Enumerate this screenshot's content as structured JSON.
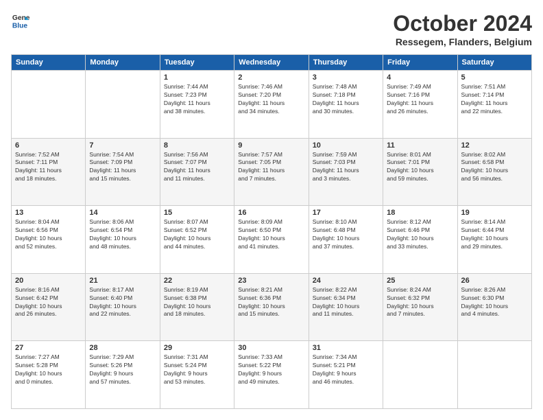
{
  "logo": {
    "line1": "General",
    "line2": "Blue"
  },
  "title": "October 2024",
  "location": "Ressegem, Flanders, Belgium",
  "days": [
    "Sunday",
    "Monday",
    "Tuesday",
    "Wednesday",
    "Thursday",
    "Friday",
    "Saturday"
  ],
  "weeks": [
    [
      {
        "day": "",
        "content": ""
      },
      {
        "day": "",
        "content": ""
      },
      {
        "day": "1",
        "content": "Sunrise: 7:44 AM\nSunset: 7:23 PM\nDaylight: 11 hours\nand 38 minutes."
      },
      {
        "day": "2",
        "content": "Sunrise: 7:46 AM\nSunset: 7:20 PM\nDaylight: 11 hours\nand 34 minutes."
      },
      {
        "day": "3",
        "content": "Sunrise: 7:48 AM\nSunset: 7:18 PM\nDaylight: 11 hours\nand 30 minutes."
      },
      {
        "day": "4",
        "content": "Sunrise: 7:49 AM\nSunset: 7:16 PM\nDaylight: 11 hours\nand 26 minutes."
      },
      {
        "day": "5",
        "content": "Sunrise: 7:51 AM\nSunset: 7:14 PM\nDaylight: 11 hours\nand 22 minutes."
      }
    ],
    [
      {
        "day": "6",
        "content": "Sunrise: 7:52 AM\nSunset: 7:11 PM\nDaylight: 11 hours\nand 18 minutes."
      },
      {
        "day": "7",
        "content": "Sunrise: 7:54 AM\nSunset: 7:09 PM\nDaylight: 11 hours\nand 15 minutes."
      },
      {
        "day": "8",
        "content": "Sunrise: 7:56 AM\nSunset: 7:07 PM\nDaylight: 11 hours\nand 11 minutes."
      },
      {
        "day": "9",
        "content": "Sunrise: 7:57 AM\nSunset: 7:05 PM\nDaylight: 11 hours\nand 7 minutes."
      },
      {
        "day": "10",
        "content": "Sunrise: 7:59 AM\nSunset: 7:03 PM\nDaylight: 11 hours\nand 3 minutes."
      },
      {
        "day": "11",
        "content": "Sunrise: 8:01 AM\nSunset: 7:01 PM\nDaylight: 10 hours\nand 59 minutes."
      },
      {
        "day": "12",
        "content": "Sunrise: 8:02 AM\nSunset: 6:58 PM\nDaylight: 10 hours\nand 56 minutes."
      }
    ],
    [
      {
        "day": "13",
        "content": "Sunrise: 8:04 AM\nSunset: 6:56 PM\nDaylight: 10 hours\nand 52 minutes."
      },
      {
        "day": "14",
        "content": "Sunrise: 8:06 AM\nSunset: 6:54 PM\nDaylight: 10 hours\nand 48 minutes."
      },
      {
        "day": "15",
        "content": "Sunrise: 8:07 AM\nSunset: 6:52 PM\nDaylight: 10 hours\nand 44 minutes."
      },
      {
        "day": "16",
        "content": "Sunrise: 8:09 AM\nSunset: 6:50 PM\nDaylight: 10 hours\nand 41 minutes."
      },
      {
        "day": "17",
        "content": "Sunrise: 8:10 AM\nSunset: 6:48 PM\nDaylight: 10 hours\nand 37 minutes."
      },
      {
        "day": "18",
        "content": "Sunrise: 8:12 AM\nSunset: 6:46 PM\nDaylight: 10 hours\nand 33 minutes."
      },
      {
        "day": "19",
        "content": "Sunrise: 8:14 AM\nSunset: 6:44 PM\nDaylight: 10 hours\nand 29 minutes."
      }
    ],
    [
      {
        "day": "20",
        "content": "Sunrise: 8:16 AM\nSunset: 6:42 PM\nDaylight: 10 hours\nand 26 minutes."
      },
      {
        "day": "21",
        "content": "Sunrise: 8:17 AM\nSunset: 6:40 PM\nDaylight: 10 hours\nand 22 minutes."
      },
      {
        "day": "22",
        "content": "Sunrise: 8:19 AM\nSunset: 6:38 PM\nDaylight: 10 hours\nand 18 minutes."
      },
      {
        "day": "23",
        "content": "Sunrise: 8:21 AM\nSunset: 6:36 PM\nDaylight: 10 hours\nand 15 minutes."
      },
      {
        "day": "24",
        "content": "Sunrise: 8:22 AM\nSunset: 6:34 PM\nDaylight: 10 hours\nand 11 minutes."
      },
      {
        "day": "25",
        "content": "Sunrise: 8:24 AM\nSunset: 6:32 PM\nDaylight: 10 hours\nand 7 minutes."
      },
      {
        "day": "26",
        "content": "Sunrise: 8:26 AM\nSunset: 6:30 PM\nDaylight: 10 hours\nand 4 minutes."
      }
    ],
    [
      {
        "day": "27",
        "content": "Sunrise: 7:27 AM\nSunset: 5:28 PM\nDaylight: 10 hours\nand 0 minutes."
      },
      {
        "day": "28",
        "content": "Sunrise: 7:29 AM\nSunset: 5:26 PM\nDaylight: 9 hours\nand 57 minutes."
      },
      {
        "day": "29",
        "content": "Sunrise: 7:31 AM\nSunset: 5:24 PM\nDaylight: 9 hours\nand 53 minutes."
      },
      {
        "day": "30",
        "content": "Sunrise: 7:33 AM\nSunset: 5:22 PM\nDaylight: 9 hours\nand 49 minutes."
      },
      {
        "day": "31",
        "content": "Sunrise: 7:34 AM\nSunset: 5:21 PM\nDaylight: 9 hours\nand 46 minutes."
      },
      {
        "day": "",
        "content": ""
      },
      {
        "day": "",
        "content": ""
      }
    ]
  ]
}
